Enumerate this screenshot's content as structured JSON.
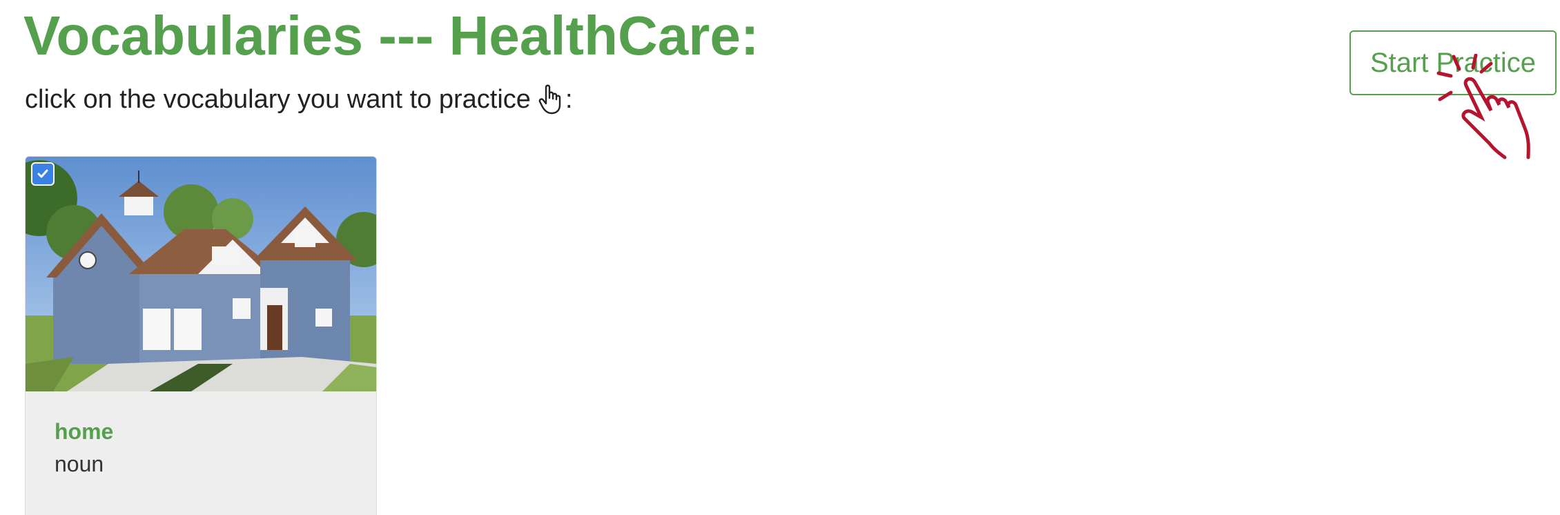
{
  "header": {
    "title": "Vocabularies --- HealthCare:",
    "instruction": "click on the vocabulary you want to practice",
    "instruction_suffix": ":"
  },
  "actions": {
    "start_practice_label": "Start Practice"
  },
  "vocabulary_cards": [
    {
      "word": "home",
      "part_of_speech": "noun",
      "selected": true,
      "image_subject": "house"
    }
  ],
  "colors": {
    "accent_green": "#55a04c",
    "checkbox_blue": "#3b82e6",
    "hand_red": "#b5142f"
  },
  "icons": {
    "instruction_icon": "pointer-hand-icon",
    "button_overlay_icon": "click-hand-icon",
    "card_check_icon": "checkmark-icon"
  }
}
